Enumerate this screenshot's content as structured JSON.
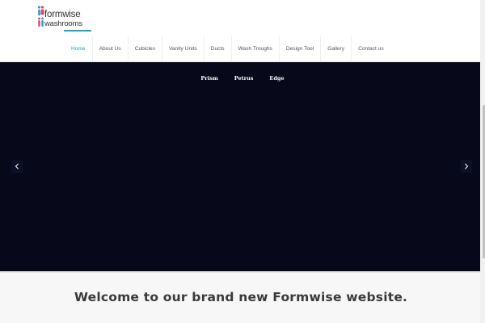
{
  "logo": {
    "line1": "formwise",
    "line2": "washrooms",
    "accent_color": "#1ba3c6"
  },
  "nav": {
    "items": [
      {
        "label": "Home",
        "active": true
      },
      {
        "label": "About Us"
      },
      {
        "label": "Cubicles"
      },
      {
        "label": "Vanity Units"
      },
      {
        "label": "Ducts"
      },
      {
        "label": "Wash Troughs"
      },
      {
        "label": "Design Tool"
      },
      {
        "label": "Gallery"
      },
      {
        "label": "Contact us"
      }
    ]
  },
  "slider": {
    "tabs": [
      "Prism",
      "Petrus",
      "Edge"
    ],
    "background": "#07091b",
    "prev_icon": "chevron-left-icon",
    "next_icon": "chevron-right-icon"
  },
  "welcome": {
    "heading": "Welcome to our brand new Formwise website."
  }
}
